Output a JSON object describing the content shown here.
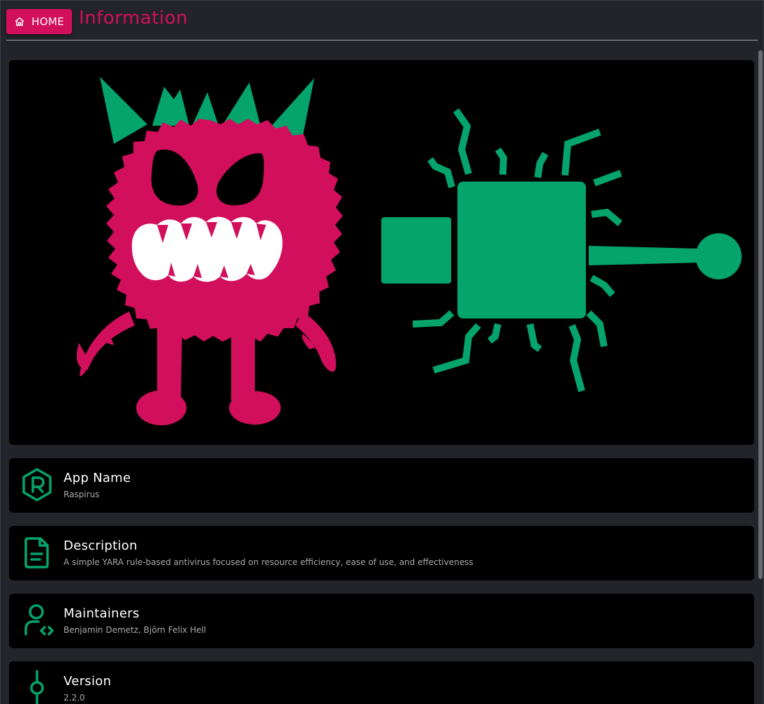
{
  "header": {
    "home_label": "HOME",
    "title": "Information",
    "accent_color": "#d20f5c"
  },
  "hero": {
    "monster_color": "#d20f5c",
    "gun_color": "#04a46c"
  },
  "info": [
    {
      "icon": "logo-r-hexagon-icon",
      "title": "App Name",
      "value": "Raspirus"
    },
    {
      "icon": "file-text-icon",
      "title": "Description",
      "value": "A simple YARA rule-based antivirus focused on resource efficiency, ease of use, and effectiveness"
    },
    {
      "icon": "user-code-icon",
      "title": "Maintainers",
      "value": "Benjamin Demetz,  Björn Felix Hell"
    },
    {
      "icon": "git-commit-icon",
      "title": "Version",
      "value": "2.2.0"
    }
  ],
  "colors": {
    "background": "#222429",
    "card": "#000000",
    "icon_green": "#04a46c",
    "text_primary": "#ffffff",
    "text_secondary": "#a8a9ad"
  }
}
